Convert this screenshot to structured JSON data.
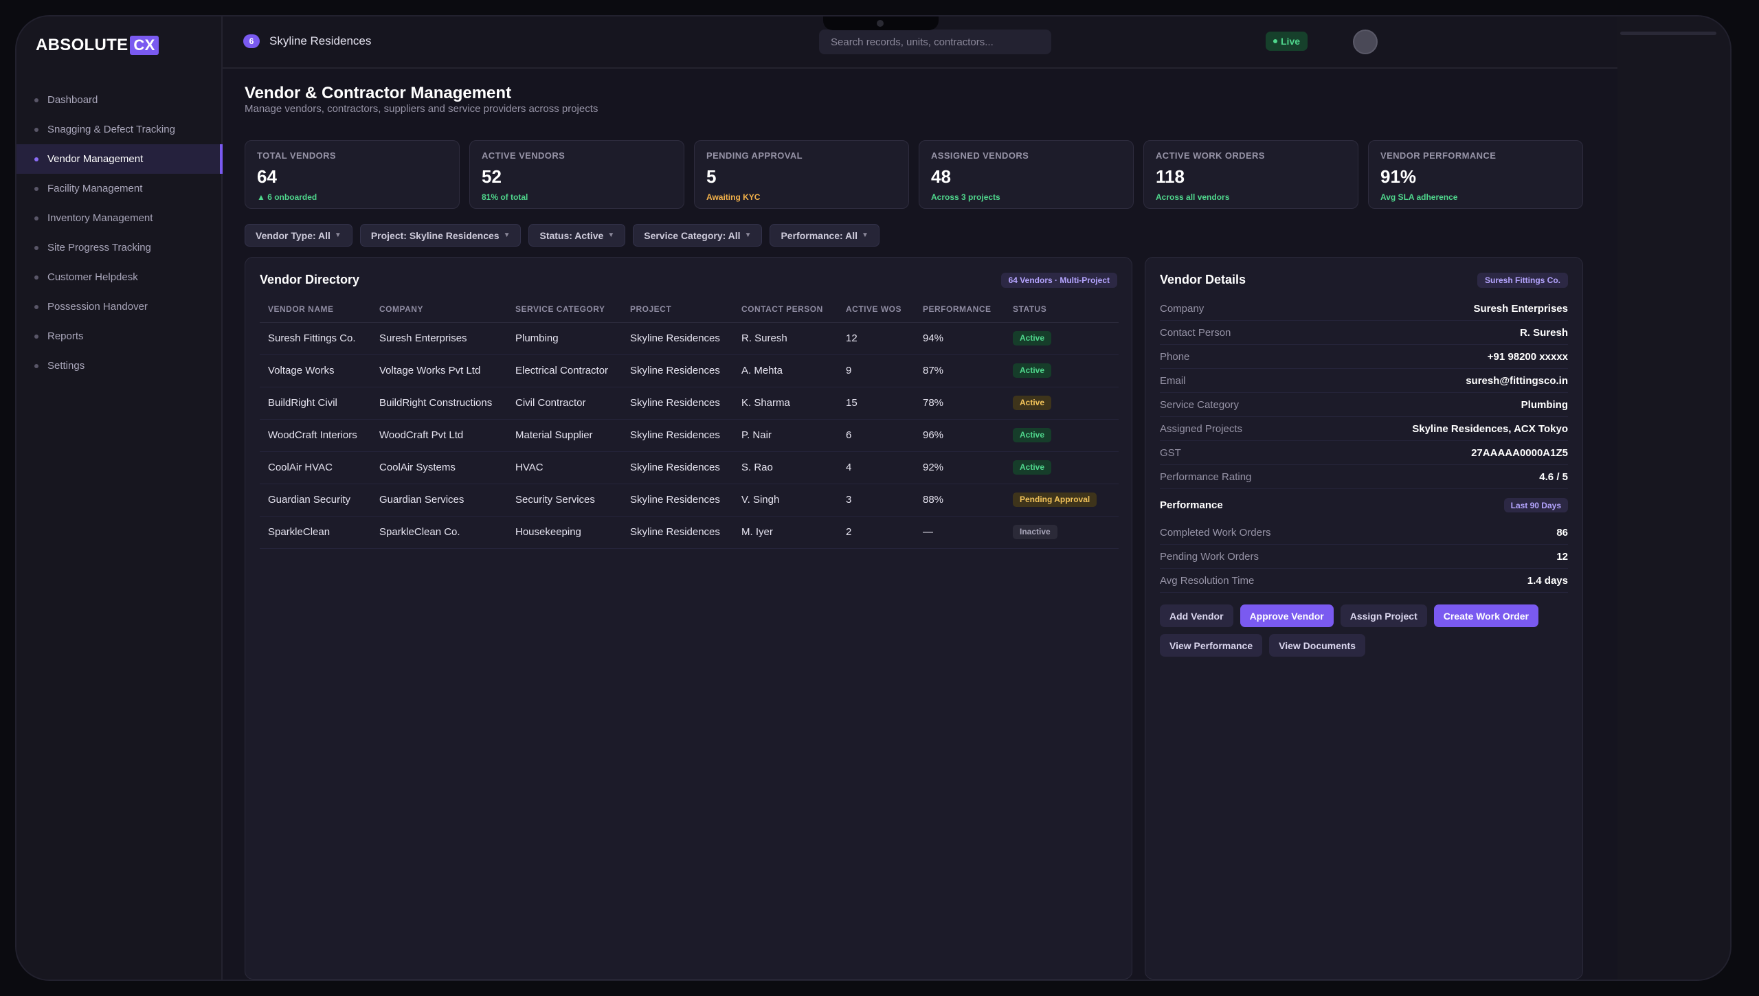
{
  "app": {
    "logo_text": "ABSOLUTE",
    "logo_accent": "CX",
    "accent_color": "#7a5af0"
  },
  "sidebar": {
    "items": [
      {
        "label": "Dashboard"
      },
      {
        "label": "Snagging & Defect Tracking"
      },
      {
        "label": "Vendor Management",
        "active": true
      },
      {
        "label": "Facility Management"
      },
      {
        "label": "Inventory Management"
      },
      {
        "label": "Site Progress Tracking"
      },
      {
        "label": "Customer Helpdesk"
      },
      {
        "label": "Possession Handover"
      },
      {
        "label": "Reports"
      },
      {
        "label": "Settings"
      }
    ]
  },
  "topbar": {
    "project_count": "6",
    "project_name": "Skyline Residences",
    "search_placeholder": "Search records, units, contractors...",
    "live_label": "Live"
  },
  "page": {
    "title": "Vendor & Contractor Management",
    "subtitle": "Manage vendors, contractors, suppliers and service providers across projects"
  },
  "stats": [
    {
      "label": "TOTAL VENDORS",
      "value": "64",
      "note": "▲ 6 onboarded",
      "tone": "green"
    },
    {
      "label": "ACTIVE VENDORS",
      "value": "52",
      "note": "81% of total",
      "tone": "green"
    },
    {
      "label": "PENDING APPROVAL",
      "value": "5",
      "note": "Awaiting KYC",
      "tone": "amber"
    },
    {
      "label": "ASSIGNED VENDORS",
      "value": "48",
      "note": "Across 3 projects",
      "tone": "green"
    },
    {
      "label": "ACTIVE WORK ORDERS",
      "value": "118",
      "note": "Across all vendors",
      "tone": "green"
    },
    {
      "label": "VENDOR PERFORMANCE",
      "value": "91%",
      "note": "Avg SLA adherence",
      "tone": "green"
    }
  ],
  "filters": [
    {
      "label": "Vendor Type: All"
    },
    {
      "label": "Project: Skyline Residences"
    },
    {
      "label": "Status: Active"
    },
    {
      "label": "Service Category: All"
    },
    {
      "label": "Performance: All"
    }
  ],
  "directory": {
    "title": "Vendor Directory",
    "tag": "64 Vendors · Multi-Project",
    "columns": [
      "VENDOR NAME",
      "COMPANY",
      "SERVICE CATEGORY",
      "PROJECT",
      "CONTACT PERSON",
      "ACTIVE WOS",
      "PERFORMANCE",
      "STATUS"
    ],
    "rows": [
      {
        "vendor": "Suresh Fittings Co.",
        "company": "Suresh Enterprises",
        "category": "Plumbing",
        "project": "Skyline Residences",
        "contact": "R. Suresh",
        "wos": "12",
        "perf": "94%",
        "status": "Active",
        "status_tone": "active"
      },
      {
        "vendor": "Voltage Works",
        "company": "Voltage Works Pvt Ltd",
        "category": "Electrical Contractor",
        "project": "Skyline Residences",
        "contact": "A. Mehta",
        "wos": "9",
        "perf": "87%",
        "status": "Active",
        "status_tone": "active"
      },
      {
        "vendor": "BuildRight Civil",
        "company": "BuildRight Constructions",
        "category": "Civil Contractor",
        "project": "Skyline Residences",
        "contact": "K. Sharma",
        "wos": "15",
        "perf": "78%",
        "status": "Active",
        "status_tone": "warn"
      },
      {
        "vendor": "WoodCraft Interiors",
        "company": "WoodCraft Pvt Ltd",
        "category": "Material Supplier",
        "project": "Skyline Residences",
        "contact": "P. Nair",
        "wos": "6",
        "perf": "96%",
        "status": "Active",
        "status_tone": "active"
      },
      {
        "vendor": "CoolAir HVAC",
        "company": "CoolAir Systems",
        "category": "HVAC",
        "project": "Skyline Residences",
        "contact": "S. Rao",
        "wos": "4",
        "perf": "92%",
        "status": "Active",
        "status_tone": "active"
      },
      {
        "vendor": "Guardian Security",
        "company": "Guardian Services",
        "category": "Security Services",
        "project": "Skyline Residences",
        "contact": "V. Singh",
        "wos": "3",
        "perf": "88%",
        "status": "Pending Approval",
        "status_tone": "pending"
      },
      {
        "vendor": "SparkleClean",
        "company": "SparkleClean Co.",
        "category": "Housekeeping",
        "project": "Skyline Residences",
        "contact": "M. Iyer",
        "wos": "2",
        "perf": "—",
        "status": "Inactive",
        "status_tone": "inactive"
      }
    ]
  },
  "details": {
    "title": "Vendor Details",
    "tag": "Suresh Fittings Co.",
    "fields": [
      {
        "k": "Company",
        "v": "Suresh Enterprises"
      },
      {
        "k": "Contact Person",
        "v": "R. Suresh"
      },
      {
        "k": "Phone",
        "v": "+91 98200 xxxxx"
      },
      {
        "k": "Email",
        "v": "suresh@fittingsco.in"
      },
      {
        "k": "Service Category",
        "v": "Plumbing"
      },
      {
        "k": "Assigned Projects",
        "v": "Skyline Residences, ACX Tokyo"
      },
      {
        "k": "GST",
        "v": "27AAAAA0000A1Z5"
      },
      {
        "k": "Performance Rating",
        "v": "4.6 / 5"
      }
    ],
    "performance_title": "Performance",
    "performance_tag": "Last 90 Days",
    "performance": [
      {
        "k": "Completed Work Orders",
        "v": "86"
      },
      {
        "k": "Pending Work Orders",
        "v": "12"
      },
      {
        "k": "Avg Resolution Time",
        "v": "1.4 days"
      }
    ],
    "actions": [
      {
        "label": "Add Vendor",
        "primary": false
      },
      {
        "label": "Approve Vendor",
        "primary": true
      },
      {
        "label": "Assign Project",
        "primary": false
      },
      {
        "label": "Create Work Order",
        "primary": true
      },
      {
        "label": "View Performance",
        "primary": false
      },
      {
        "label": "View Documents",
        "primary": false
      }
    ]
  }
}
